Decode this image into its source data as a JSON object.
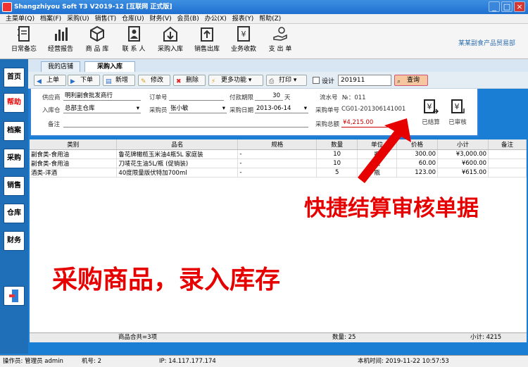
{
  "window": {
    "title": "Shangzhiyou Soft T3 V2019-12 [互联网 正式版]",
    "minimize": "_",
    "maximize": "□",
    "close": "×"
  },
  "menu": [
    "主菜单(Q)",
    "档案(F)",
    "采购(U)",
    "销售(T)",
    "仓库(U)",
    "财务(V)",
    "会员(B)",
    "办公(X)",
    "报表(Y)",
    "帮助(Z)"
  ],
  "toolbar": {
    "items": [
      {
        "label": "日常备忘",
        "icon": "notebook-icon"
      },
      {
        "label": "经营报告",
        "icon": "bar-chart-icon"
      },
      {
        "label": "商 品 库",
        "icon": "box-icon"
      },
      {
        "label": "联 系 人",
        "icon": "contacts-icon"
      },
      {
        "label": "采购入库",
        "icon": "warehouse-in-icon"
      },
      {
        "label": "销售出库",
        "icon": "upload-icon"
      },
      {
        "label": "业务收款",
        "icon": "yen-doc-icon"
      },
      {
        "label": "支 出 单",
        "icon": "hand-coin-icon"
      }
    ],
    "company": "某某副食产品贸易部"
  },
  "sidenav": [
    "首页",
    "帮助",
    "档案",
    "采购",
    "销售",
    "仓库",
    "财务"
  ],
  "tabs": [
    "我的店铺",
    "采购入库"
  ],
  "actions": {
    "prev": "上单",
    "next": "下单",
    "new": "新增",
    "edit": "修改",
    "delete": "删除",
    "more": "更多功能",
    "print": "打印",
    "design": "设计",
    "search_value": "201911",
    "query": "查询"
  },
  "form": {
    "supplier_label": "供应商",
    "supplier": "明利副食批发商行",
    "order_label": "订单号",
    "order": "",
    "term_label": "付款期限",
    "term": "30",
    "term_unit": "天",
    "flow_label": "流水号",
    "flow": "№：011",
    "warehouse_label": "入库仓",
    "warehouse": "总部主仓库",
    "buyer_label": "采购员",
    "buyer": "张小敏",
    "date_label": "采购日期",
    "date": "2013-06-14",
    "no_label": "采购单号",
    "no": "CG01-201306141001",
    "note_label": "备注",
    "note": "",
    "total_label": "采购总额",
    "total": "¥4,215.00",
    "settled": "已结算",
    "audited": "已审核"
  },
  "table": {
    "headers": [
      "类别",
      "品名",
      "规格",
      "数量",
      "单位",
      "价格",
      "小计",
      "备注"
    ],
    "rows": [
      [
        "副食类-食用油",
        "鲁花牌橄榄玉米油4瓶5L 家庭装",
        "-",
        "10",
        "瓶",
        "300.00",
        "¥3,000.00",
        ""
      ],
      [
        "副食类-食用油",
        "刀唛花生油5L/瓶 (促销装)",
        "-",
        "10",
        "瓶",
        "60.00",
        "¥600.00",
        ""
      ],
      [
        "酒类-洋酒",
        "40度限量版伏特加700ml",
        "-",
        "5",
        "瓶",
        "123.00",
        "¥615.00",
        ""
      ]
    ]
  },
  "footer": {
    "count": "商品合共=3项",
    "qty": "数量: 25",
    "subtotal": "小计: 4215"
  },
  "status": {
    "operator": "操作员: 管理员 admin",
    "machine": "机号: 2",
    "ip": "IP: 14.117.177.174",
    "time": "本机时间: 2019-11-22 10:57:53"
  },
  "annotations": {
    "quick": "快捷结算审核单据",
    "purchase": "采购商品，录入库存"
  },
  "colors": {
    "titlebar": "#1f6fd0",
    "sidenav": "#1f6fb8",
    "accent": "#2f7fd6",
    "annotation": "#e60000"
  }
}
